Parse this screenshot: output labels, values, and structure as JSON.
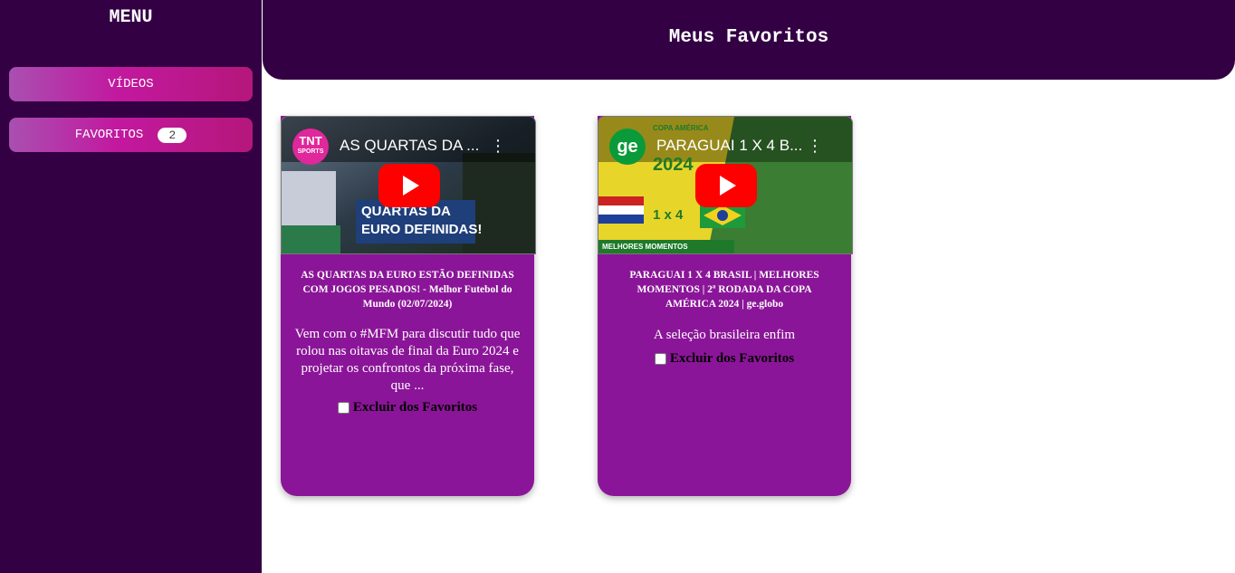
{
  "sidebar": {
    "title": "MENU",
    "items": [
      {
        "label": "VÍDEOS"
      },
      {
        "label": "FAVORITOS",
        "badge": "2"
      }
    ]
  },
  "header": {
    "title": "Meus Favoritos"
  },
  "cards": [
    {
      "video_title": "AS QUARTAS DA ...",
      "channel_logo_text": "TNT",
      "channel_logo_sub": "SPORTS",
      "thumb_text_1": "QUARTAS DA",
      "thumb_text_2": "EURO DEFINIDAS!",
      "title": "AS QUARTAS DA EURO ESTÃO DEFINIDAS COM JOGOS PESADOS! - Melhor Futebol do Mundo (02/07/2024)",
      "description": "Vem com o #MFM para discutir tudo que rolou nas oitavas de final da Euro 2024 e projetar os confrontos da próxima fase, que ...",
      "remove_label": "Excluir dos Favoritos"
    },
    {
      "video_title": "PARAGUAI 1 X 4 B...",
      "channel_logo_text": "ge",
      "thumb_text_1": "COPA AMÉRICA",
      "thumb_text_2": "2024",
      "thumb_text_3": "1 x 4",
      "thumb_text_4": "MELHORES MOMENTOS",
      "title": "PARAGUAI 1 X 4 BRASIL | MELHORES MOMENTOS | 2ª RODADA DA COPA AMÉRICA 2024 | ge.globo",
      "description": "A seleção brasileira enfim",
      "remove_label": "Excluir dos Favoritos"
    }
  ],
  "colors": {
    "sidebar_bg": "#330044",
    "card_bg": "#8b1598",
    "button_gradient_mid": "#c2189f",
    "play_red": "#ff0000"
  }
}
